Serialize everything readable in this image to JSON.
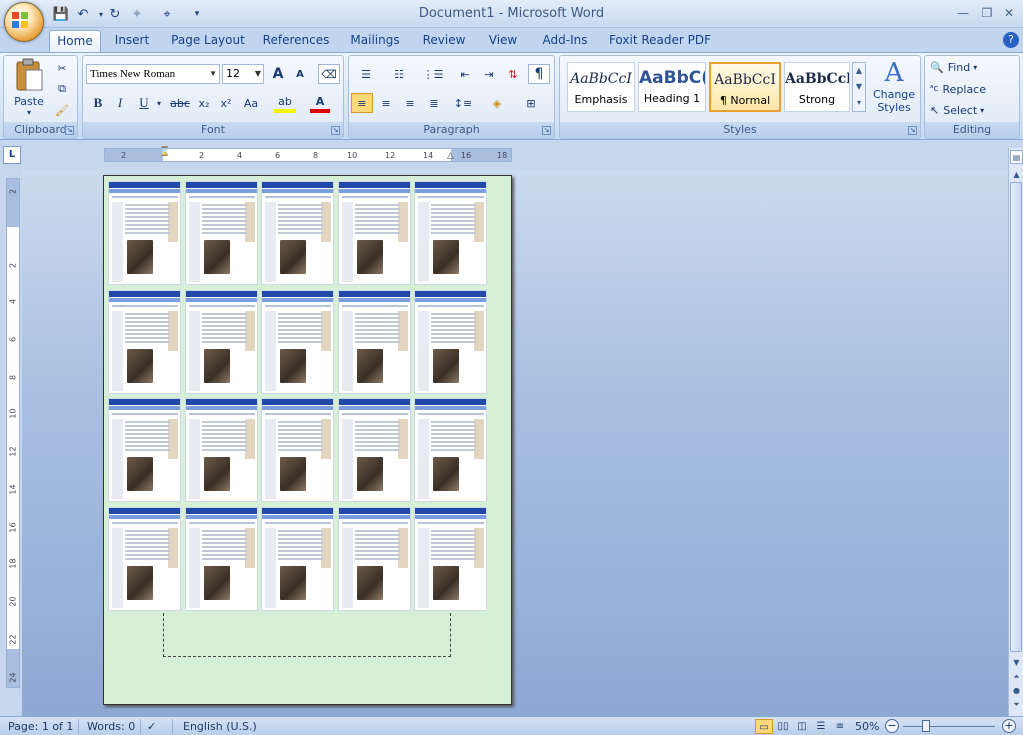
{
  "window": {
    "title": "Document1 - Microsoft Word"
  },
  "qat": {
    "save": "💾",
    "undo": "↶",
    "redo": "↻"
  },
  "tabs": [
    {
      "label": "Home"
    },
    {
      "label": "Insert"
    },
    {
      "label": "Page Layout"
    },
    {
      "label": "References"
    },
    {
      "label": "Mailings"
    },
    {
      "label": "Review"
    },
    {
      "label": "View"
    },
    {
      "label": "Add-Ins"
    },
    {
      "label": "Foxit Reader PDF"
    }
  ],
  "clipboard": {
    "group_label": "Clipboard",
    "paste_label": "Paste"
  },
  "font": {
    "group_label": "Font",
    "family": "Times New Roman",
    "size": "12",
    "grow": "A",
    "shrink": "A",
    "bold": "B",
    "italic": "I",
    "underline": "U",
    "strike": "abc",
    "subscript": "x₂",
    "superscript": "x²",
    "change_case": "Aa"
  },
  "paragraph": {
    "group_label": "Paragraph",
    "pilcrow": "¶"
  },
  "styles": {
    "group_label": "Styles",
    "items": [
      {
        "sample": "AaBbCcI",
        "name": "Emphasis"
      },
      {
        "sample": "AaBbC(",
        "name": "Heading 1"
      },
      {
        "sample": "AaBbCcI",
        "name": "¶ Normal"
      },
      {
        "sample": "AaBbCcl",
        "name": "Strong"
      }
    ],
    "change_styles_line1": "Change",
    "change_styles_line2": "Styles"
  },
  "editing": {
    "group_label": "Editing",
    "find": "Find",
    "replace": "Replace",
    "select": "Select"
  },
  "ruler": {
    "h_labels": [
      "2",
      "2",
      "4",
      "6",
      "8",
      "10",
      "12",
      "14",
      "16",
      "18"
    ],
    "v_labels": [
      "2",
      "2",
      "4",
      "6",
      "8",
      "10",
      "12",
      "14",
      "16",
      "18",
      "20",
      "22",
      "24"
    ]
  },
  "status": {
    "page": "Page: 1 of 1",
    "words": "Words: 0",
    "language": "English (U.S.)",
    "zoom": "50%",
    "zoom_out": "−",
    "zoom_in": "+"
  },
  "colors": {
    "accent": "#15428b",
    "page_fill": "#d6f0d8"
  }
}
